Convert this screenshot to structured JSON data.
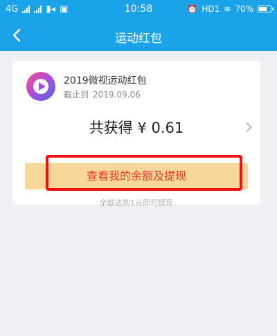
{
  "status_bar": {
    "network": "4G",
    "time": "10:58",
    "carrier": "HD1",
    "battery": "70%",
    "battery_level": 0.7
  },
  "header": {
    "back_icon": "chevron-left-icon",
    "title": "运动红包"
  },
  "card": {
    "app_name": "2019微视运动红包",
    "deadline_label": "截止到",
    "deadline_date": "2019.09.06",
    "total_text": "共获得 ¥ 0.61",
    "withdraw_label": "查看我的余额及提现",
    "hint": "余额达到1元即可提现"
  },
  "colors": {
    "header_bg": "#1aa3e8",
    "button_bg": "#f7d79a",
    "button_text": "#e53a2e",
    "highlight": "#ee1111"
  }
}
